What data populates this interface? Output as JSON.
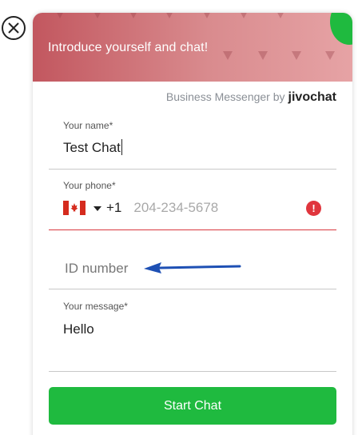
{
  "header": {
    "title": "Introduce yourself and chat!",
    "color": "#c2575f"
  },
  "powered_by": {
    "text": "Business Messenger by",
    "brand": "jivochat"
  },
  "form": {
    "name": {
      "label": "Your name*",
      "value": "Test Chat"
    },
    "phone": {
      "label": "Your phone*",
      "country": "Canada",
      "dial_code": "+1",
      "placeholder": "204-234-5678",
      "error_icon": "!"
    },
    "id_number": {
      "placeholder": "ID number"
    },
    "message": {
      "label": "Your message*",
      "value": "Hello"
    }
  },
  "start_button": {
    "label": "Start Chat",
    "color": "#1fba3f"
  },
  "icons": {
    "close": "close-icon",
    "flag": "canada-flag-icon",
    "dropdown": "caret-down-icon",
    "error": "error-icon",
    "arrow": "blue-arrow-annotation"
  }
}
